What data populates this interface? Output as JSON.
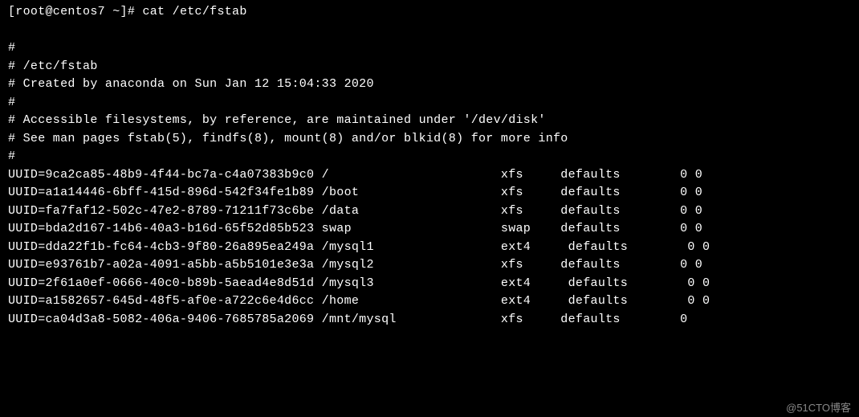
{
  "prompt": "[root@centos7 ~]# ",
  "command": "cat /etc/fstab",
  "comments": [
    "",
    "#",
    "# /etc/fstab",
    "# Created by anaconda on Sun Jan 12 15:04:33 2020",
    "#",
    "# Accessible filesystems, by reference, are maintained under '/dev/disk'",
    "# See man pages fstab(5), findfs(8), mount(8) and/or blkid(8) for more info",
    "#"
  ],
  "entries": [
    "UUID=9ca2ca85-48b9-4f44-bc7a-c4a07383b9c0 /                       xfs     defaults        0 0",
    "UUID=a1a14446-6bff-415d-896d-542f34fe1b89 /boot                   xfs     defaults        0 0",
    "UUID=fa7faf12-502c-47e2-8789-71211f73c6be /data                   xfs     defaults        0 0",
    "UUID=bda2d167-14b6-40a3-b16d-65f52d85b523 swap                    swap    defaults        0 0",
    "UUID=dda22f1b-fc64-4cb3-9f80-26a895ea249a /mysql1                 ext4     defaults        0 0",
    "UUID=e93761b7-a02a-4091-a5bb-a5b5101e3e3a /mysql2                 xfs     defaults        0 0",
    "UUID=2f61a0ef-0666-40c0-b89b-5aead4e8d51d /mysql3                 ext4     defaults        0 0",
    "UUID=a1582657-645d-48f5-af0e-a722c6e4d6cc /home                   ext4     defaults        0 0",
    "UUID=ca04d3a8-5082-406a-9406-7685785a2069 /mnt/mysql              xfs     defaults        0 "
  ],
  "watermark": "@51CTO博客"
}
